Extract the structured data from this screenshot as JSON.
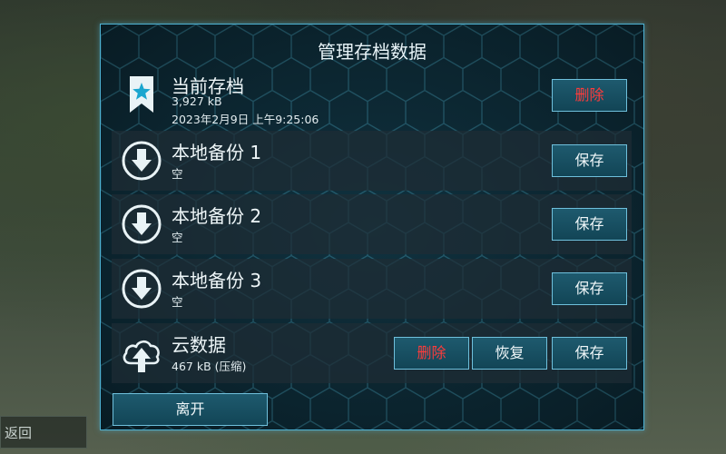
{
  "background": {
    "back_label": "返回"
  },
  "dialog": {
    "title": "管理存档数据",
    "current": {
      "title": "当前存档",
      "size": "3,927 kB",
      "date": "2023年2月9日 上午9:25:06",
      "delete_label": "删除",
      "icon": "bookmark-star-icon"
    },
    "locals": [
      {
        "title": "本地备份 1",
        "status": "空",
        "save_label": "保存",
        "icon": "download-arrow-icon"
      },
      {
        "title": "本地备份 2",
        "status": "空",
        "save_label": "保存",
        "icon": "download-arrow-icon"
      },
      {
        "title": "本地备份 3",
        "status": "空",
        "save_label": "保存",
        "icon": "download-arrow-icon"
      }
    ],
    "cloud": {
      "title": "云数据",
      "size": "467 kB (压缩)",
      "delete_label": "删除",
      "restore_label": "恢复",
      "save_label": "保存",
      "icon": "cloud-upload-icon"
    },
    "leave_label": "离开"
  },
  "colors": {
    "accent": "#4fb3d4",
    "delete_text": "#ff3b3b",
    "panel_bg": "#0b2530"
  }
}
